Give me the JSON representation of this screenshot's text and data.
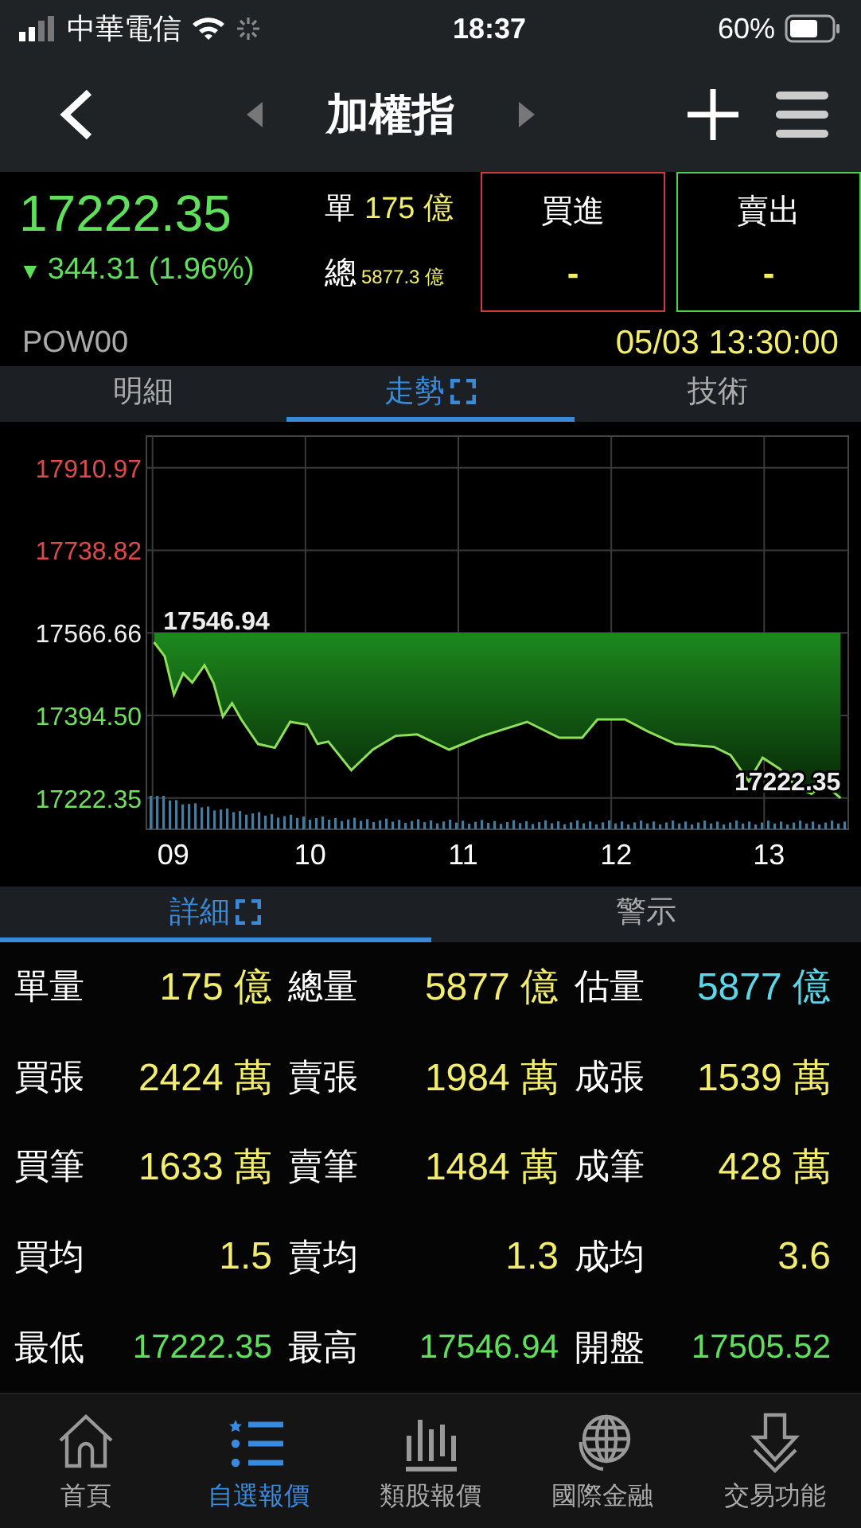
{
  "status_bar": {
    "carrier": "中華電信",
    "time": "18:37",
    "battery": "60%"
  },
  "nav": {
    "title": "加權指"
  },
  "quote": {
    "price": "17222.35",
    "arrow": "▼",
    "change": "344.31 (1.96%)",
    "single_label": "單",
    "single_value": "175 億",
    "total_label": "總",
    "total_value": "5877.3 億",
    "code": "POW00",
    "datetime": "05/03 13:30:00"
  },
  "order_buttons": [
    {
      "kind": "buy",
      "label": "買進",
      "value": "-"
    },
    {
      "kind": "sell",
      "label": "賣出",
      "value": "-"
    }
  ],
  "chart_tabs": [
    {
      "label": "明細",
      "selected": false
    },
    {
      "label": "走勢",
      "selected": true
    },
    {
      "label": "技術",
      "selected": false
    }
  ],
  "chart": {
    "chart_data": {
      "type": "line",
      "x": [
        9.01,
        9.08,
        9.14,
        9.2,
        9.26,
        9.34,
        9.4,
        9.46,
        9.52,
        9.58,
        9.69,
        9.8,
        9.9,
        10.01,
        10.08,
        10.15,
        10.3,
        10.44,
        10.59,
        10.73,
        10.94,
        11.16,
        11.45,
        11.66,
        11.81,
        11.91,
        12.09,
        12.24,
        12.42,
        12.67,
        12.78,
        12.9,
        12.99,
        13.1,
        13.22,
        13.31,
        13.39,
        13.5
      ],
      "series": [
        {
          "color": "#8ee05a",
          "values": [
            17547,
            17518,
            17438,
            17482,
            17463,
            17499,
            17461,
            17392,
            17420,
            17386,
            17335,
            17327,
            17381,
            17375,
            17335,
            17340,
            17280,
            17323,
            17352,
            17355,
            17323,
            17352,
            17381,
            17348,
            17348,
            17386,
            17386,
            17361,
            17335,
            17329,
            17312,
            17257,
            17306,
            17283,
            17243,
            17231,
            17252,
            17222
          ]
        }
      ],
      "grid": true,
      "xlim": [
        8.96,
        13.55
      ],
      "ylim": [
        17157,
        17977
      ],
      "xticks": [
        {
          "value": 9,
          "label": "09"
        },
        {
          "value": 10,
          "label": "10"
        },
        {
          "value": 11,
          "label": "11"
        },
        {
          "value": 12,
          "label": "12"
        },
        {
          "value": 13,
          "label": "13"
        }
      ],
      "yticks": [
        {
          "value": 17910.97,
          "label": "17910.97"
        },
        {
          "value": 17738.82,
          "label": "17738.82"
        },
        {
          "value": 17566.66,
          "label": "17566.66"
        },
        {
          "value": 17394.5,
          "label": "17394.50"
        },
        {
          "value": 17222.35,
          "label": "17222.35"
        }
      ],
      "annotations": [
        {
          "x": 9.05,
          "y": 17546.94,
          "text": "17546.94"
        },
        {
          "x": 13.5,
          "y": 17222.35,
          "text": "17222.35"
        }
      ]
    }
  },
  "detail_tabs": [
    {
      "label": "詳細",
      "selected": true
    },
    {
      "label": "警示",
      "selected": false
    }
  ],
  "stats": [
    [
      {
        "label": "單量",
        "value": "175 億",
        "color": "#f2ee6a"
      },
      {
        "label": "總量",
        "value": "5877 億",
        "color": "#f2ee6a"
      },
      {
        "label": "估量",
        "value": "5877 億",
        "color": "#5ad8ea"
      }
    ],
    [
      {
        "label": "買張",
        "value": "2424 萬",
        "color": "#f2ee6a"
      },
      {
        "label": "賣張",
        "value": "1984 萬",
        "color": "#f2ee6a"
      },
      {
        "label": "成張",
        "value": "1539 萬",
        "color": "#f2ee6a"
      }
    ],
    [
      {
        "label": "買筆",
        "value": "1633 萬",
        "color": "#f2ee6a"
      },
      {
        "label": "賣筆",
        "value": "1484 萬",
        "color": "#f2ee6a"
      },
      {
        "label": "成筆",
        "value": "428 萬",
        "color": "#f2ee6a"
      }
    ],
    [
      {
        "label": "買均",
        "value": "1.5",
        "color": "#f2ee6a"
      },
      {
        "label": "賣均",
        "value": "1.3",
        "color": "#f2ee6a"
      },
      {
        "label": "成均",
        "value": "3.6",
        "color": "#f2ee6a"
      }
    ],
    [
      {
        "label": "最低",
        "value": "17222.35",
        "color": "#5ee05a"
      },
      {
        "label": "最高",
        "value": "17546.94",
        "color": "#5ee05a"
      },
      {
        "label": "開盤",
        "value": "17505.52",
        "color": "#5ee05a"
      }
    ]
  ],
  "tab_bar": [
    {
      "kind": "home",
      "label": "首頁",
      "selected": false
    },
    {
      "kind": "watchlist",
      "label": "自選報價",
      "selected": true
    },
    {
      "kind": "sectors",
      "label": "類股報價",
      "selected": false
    },
    {
      "kind": "global",
      "label": "國際金融",
      "selected": false
    },
    {
      "kind": "trade",
      "label": "交易功能",
      "selected": false
    }
  ]
}
